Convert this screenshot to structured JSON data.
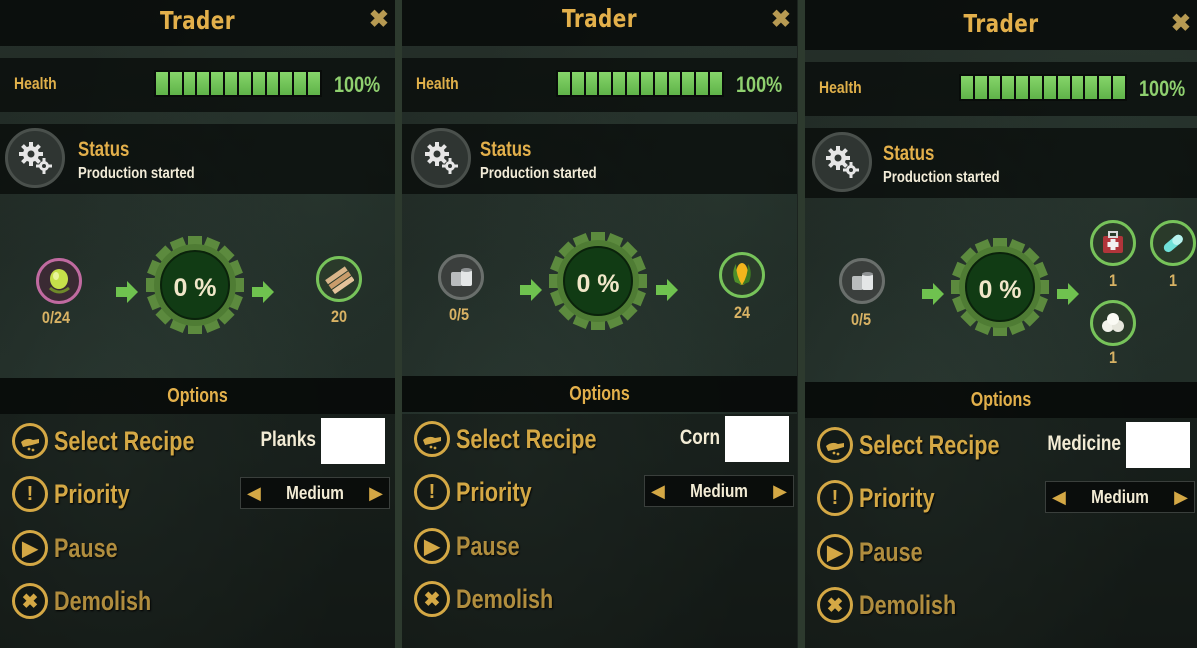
{
  "panels": [
    {
      "title": "Trader",
      "health_label": "Health",
      "health_value": "100%",
      "status_title": "Status",
      "status_text": "Production started",
      "inputs": [
        {
          "icon": "lime-icon",
          "count": "0/24"
        }
      ],
      "progress": "0 %",
      "outputs": [
        {
          "icon": "planks-icon",
          "count": "20"
        }
      ],
      "options_title": "Options",
      "actions": {
        "select_recipe": "Select Recipe",
        "priority": "Priority",
        "pause": "Pause",
        "demolish": "Demolish"
      },
      "recipe": "Planks",
      "priority_value": "Medium"
    },
    {
      "title": "Trader",
      "health_label": "Health",
      "health_value": "100%",
      "status_title": "Status",
      "status_text": "Production started",
      "inputs": [
        {
          "icon": "cans-icon",
          "count": "0/5"
        }
      ],
      "progress": "0 %",
      "outputs": [
        {
          "icon": "corn-icon",
          "count": "24"
        }
      ],
      "options_title": "Options",
      "actions": {
        "select_recipe": "Select Recipe",
        "priority": "Priority",
        "pause": "Pause",
        "demolish": "Demolish"
      },
      "recipe": "Corn",
      "priority_value": "Medium"
    },
    {
      "title": "Trader",
      "health_label": "Health",
      "health_value": "100%",
      "status_title": "Status",
      "status_text": "Production started",
      "inputs": [
        {
          "icon": "cans-icon",
          "count": "0/5"
        }
      ],
      "progress": "0 %",
      "outputs": [
        {
          "icon": "medkit-icon",
          "count": "1"
        },
        {
          "icon": "pills-icon",
          "count": "1"
        },
        {
          "icon": "bandage-rolls-icon",
          "count": "1"
        }
      ],
      "options_title": "Options",
      "actions": {
        "select_recipe": "Select Recipe",
        "priority": "Priority",
        "pause": "Pause",
        "demolish": "Demolish"
      },
      "recipe": "Medicine",
      "priority_value": "Medium"
    }
  ],
  "colors": {
    "accent": "#d4a845",
    "health": "#7bcb5f",
    "gear": "#2f6b2a",
    "text": "#f3ecd5"
  }
}
